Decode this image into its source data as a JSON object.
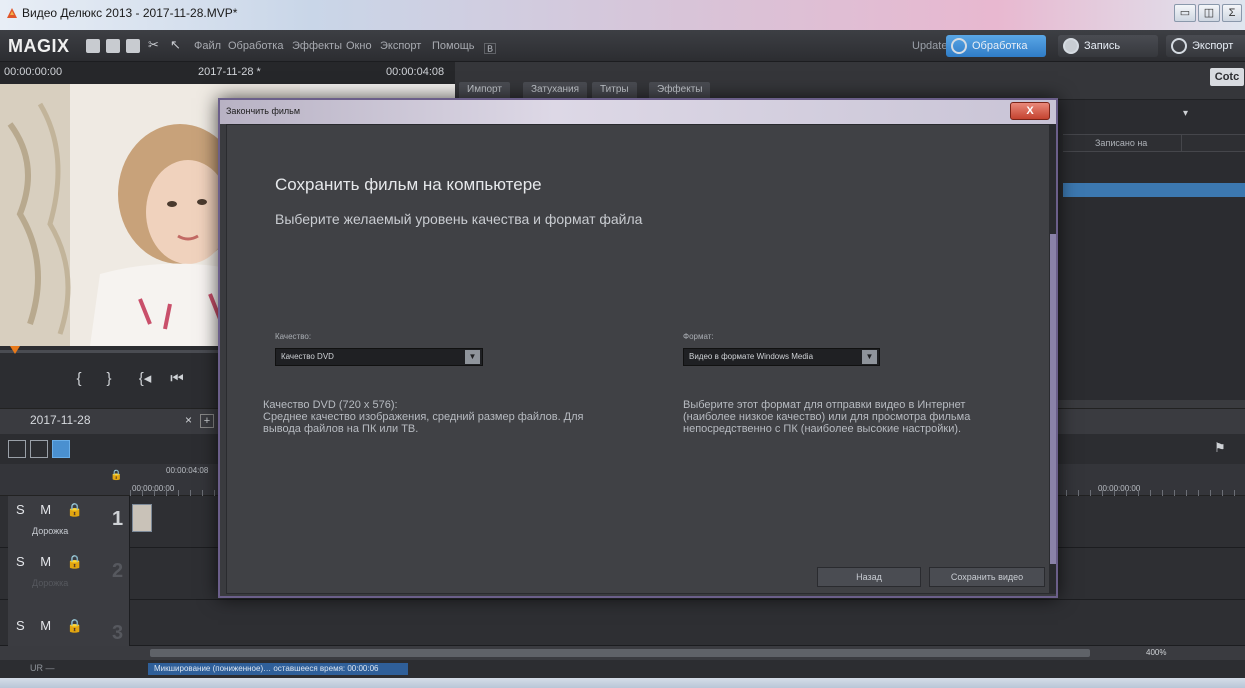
{
  "window": {
    "title": "Видео Делюкс 2013 - 2017-11-28.MVP*",
    "minimize": "▭",
    "maximize": "◫",
    "close_partial": "Σ"
  },
  "menubar": {
    "logo": "MAGIX",
    "menu_items": [
      "Файл",
      "Обработка",
      "Эффекты",
      "Окно",
      "Экспорт",
      "Помощь"
    ],
    "update_label": "Update",
    "modes": {
      "edit": "Обработка",
      "record": "Запись",
      "export": "Экспорт"
    }
  },
  "preview": {
    "timecode_left": "00:00:00:00",
    "project_label": "2017-11-28 *",
    "timecode_right": "00:00:04:08"
  },
  "media_pool": {
    "tabs": [
      "Импорт",
      "Затухания",
      "Титры",
      "Эффекты"
    ],
    "corner_logo": "Cotc",
    "column_header": "Записано на"
  },
  "timeline": {
    "tab_label": "2017-11-28",
    "close_symbol": "×",
    "add_symbol": "+",
    "ruler_start": "00:00:00:00",
    "ruler_marker": "00:00:04:08",
    "ruler_right": "00:00:00:00",
    "tracks": [
      {
        "buttons": "S M 🔒",
        "number": "1",
        "name": "Дорожка"
      },
      {
        "buttons": "S M 🔒",
        "number": "2",
        "name": "Дорожка"
      },
      {
        "buttons": "S M 🔒",
        "number": "3",
        "name": ""
      }
    ],
    "zoom_label": "400%"
  },
  "status": {
    "left": "UR —",
    "progress_text": "Микширование (пониженное)… оставшееся время: 00:00:06"
  },
  "dialog": {
    "title": "Закончить фильм",
    "close": "X",
    "heading": "Сохранить фильм на компьютере",
    "subheading": "Выберите желаемый уровень качества и формат файла",
    "quality_label": "Качество:",
    "quality_value": "Качество DVD",
    "format_label": "Формат:",
    "format_value": "Видео в формате Windows Media",
    "quality_desc_title": "Качество DVD (720 x 576):",
    "quality_desc_line1": "Среднее качество изображения, средний размер файлов. Для",
    "quality_desc_line2": "вывода файлов на ПК или ТВ.",
    "format_desc_line1": "Выберите этот формат для отправки видео в Интернет",
    "format_desc_line2": "(наиболее низкое качество) или для просмотра фильма",
    "format_desc_line3": "непосредственно с ПК (наиболее высокие настройки).",
    "back_button": "Назад",
    "save_button": "Сохранить видео"
  },
  "colors": {
    "accent_blue": "#3c78b0",
    "dialog_border": "#6b5f8a",
    "playhead": "#e97a1a"
  }
}
